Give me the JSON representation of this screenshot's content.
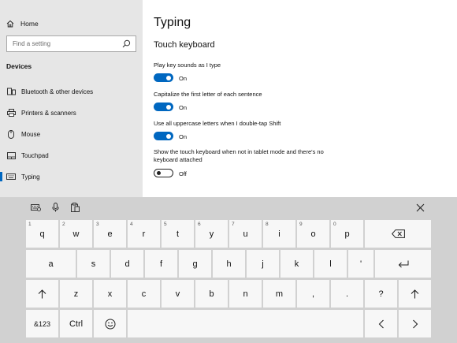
{
  "sidebar": {
    "home_label": "Home",
    "search_placeholder": "Find a setting",
    "section_label": "Devices",
    "items": [
      {
        "label": "Bluetooth & other devices",
        "icon": "bluetooth-icon"
      },
      {
        "label": "Printers & scanners",
        "icon": "printer-icon"
      },
      {
        "label": "Mouse",
        "icon": "mouse-icon"
      },
      {
        "label": "Touchpad",
        "icon": "touchpad-icon"
      },
      {
        "label": "Typing",
        "icon": "keyboard-icon",
        "active": true
      }
    ]
  },
  "main": {
    "title": "Typing",
    "subtitle": "Touch keyboard",
    "settings": [
      {
        "label": "Play key sounds as I type",
        "state": "On",
        "on": true
      },
      {
        "label": "Capitalize the first letter of each sentence",
        "state": "On",
        "on": true
      },
      {
        "label": "Use all uppercase letters when I double-tap Shift",
        "state": "On",
        "on": true
      },
      {
        "label": "Show the touch keyboard when not in tablet mode and there's no keyboard attached",
        "state": "Off",
        "on": false
      }
    ]
  },
  "keyboard": {
    "row1": [
      {
        "k": "q",
        "h": "1"
      },
      {
        "k": "w",
        "h": "2"
      },
      {
        "k": "e",
        "h": "3"
      },
      {
        "k": "r",
        "h": "4"
      },
      {
        "k": "t",
        "h": "5"
      },
      {
        "k": "y",
        "h": "6"
      },
      {
        "k": "u",
        "h": "7"
      },
      {
        "k": "i",
        "h": "8"
      },
      {
        "k": "o",
        "h": "9"
      },
      {
        "k": "p",
        "h": "0"
      }
    ],
    "row2": [
      "a",
      "s",
      "d",
      "f",
      "g",
      "h",
      "j",
      "k",
      "l",
      "'"
    ],
    "row3": [
      "z",
      "x",
      "c",
      "v",
      "b",
      "n",
      "m",
      ",",
      ".",
      "?"
    ],
    "mode_key": "&123",
    "ctrl_key": "Ctrl",
    "accent_color": "#0067c0"
  }
}
